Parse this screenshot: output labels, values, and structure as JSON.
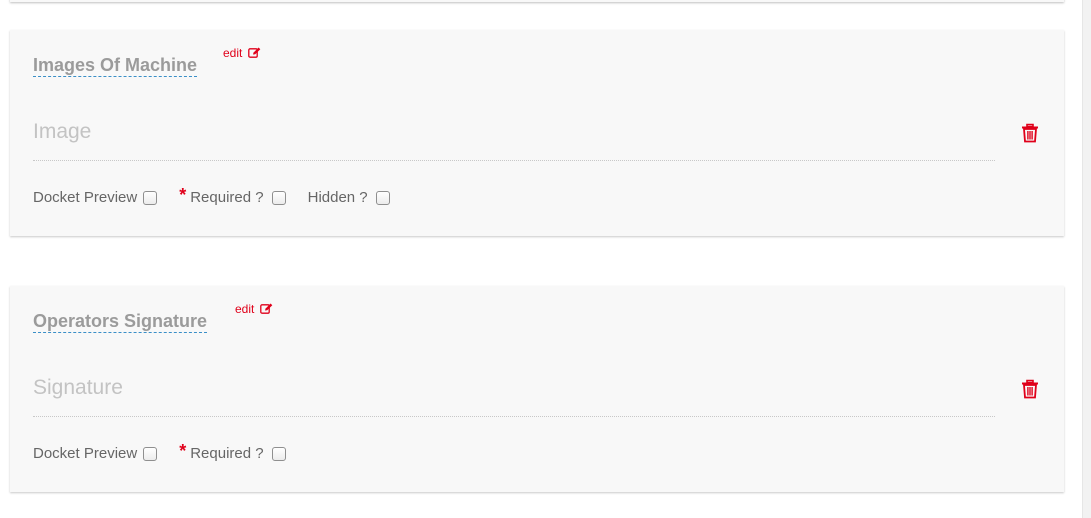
{
  "cards": [
    {
      "title": "Images Of Machine",
      "edit_label": "edit",
      "placeholder": "Image",
      "options": {
        "docket_preview": "Docket Preview",
        "required": "Required ?",
        "required_star": "*",
        "hidden": "Hidden ?"
      }
    },
    {
      "title": "Operators Signature",
      "edit_label": "edit",
      "placeholder": "Signature",
      "options": {
        "docket_preview": "Docket Preview",
        "required": "Required ?",
        "required_star": "*"
      }
    }
  ],
  "icons": {
    "edit": "edit-icon",
    "delete": "trash-icon"
  },
  "colors": {
    "accent_red": "#e0001a",
    "title_gray": "#9b9b9b",
    "underline_blue": "#3a8fc7"
  }
}
